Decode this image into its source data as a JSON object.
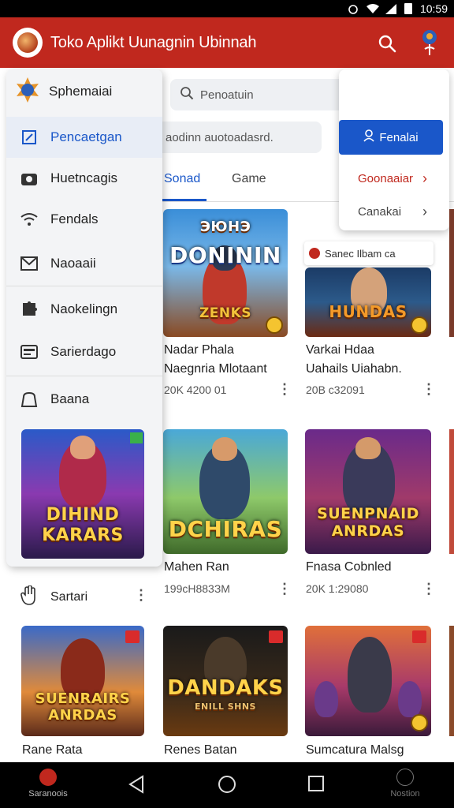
{
  "status_bar": {
    "time": "10:59"
  },
  "app_bar": {
    "title": "Toko Aplikt Uunagnin Ubinnah"
  },
  "search": {
    "placeholder": "Penoatuin"
  },
  "sub_search": {
    "text": "aodinn auotoadasrd."
  },
  "tabs": [
    {
      "label": "Sonad",
      "active": true
    },
    {
      "label": "Game",
      "active": false
    }
  ],
  "drawer": {
    "header": "Sphemaiai",
    "items": [
      {
        "label": "Pencaetgan",
        "icon": "apps-icon",
        "active": true
      },
      {
        "label": "Huetncagis",
        "icon": "camera-icon",
        "active": false
      },
      {
        "label": "Fendals",
        "icon": "wifi-icon",
        "active": false
      },
      {
        "label": "Naoaaii",
        "icon": "mail-icon",
        "active": false
      },
      {
        "label": "Naokelingn",
        "icon": "puzzle-icon",
        "active": false
      },
      {
        "label": "Sarierdago",
        "icon": "card-icon",
        "active": false
      },
      {
        "label": "Baana",
        "icon": "bag-icon",
        "active": false
      }
    ],
    "promo_title": "DIHIND KARARS"
  },
  "popup": {
    "button_label": "Fenalai",
    "items": [
      {
        "label": "Goonaaiar",
        "color": "#c0281e"
      },
      {
        "label": "Canakai",
        "color": "#444444"
      }
    ]
  },
  "chip": {
    "text": "Sanec Ilbam ca"
  },
  "games_row1": [
    {
      "art_title": "DONININ",
      "art_top": "ЭЮНЭ",
      "art_sub": "ZENKS",
      "name": "Nadar Phala\nNaegnria Mlotaant",
      "meta": "20K 4200 01"
    },
    {
      "art_title": "HUNDAS",
      "name": "Varkai Hdaa\nUahails Uiahabn.",
      "meta": "20B c32091"
    }
  ],
  "games_row2": [
    {
      "art_title": "DCHIRAS",
      "name": "Mahen Ran",
      "meta": "199cH883ЗM"
    },
    {
      "art_title": "SUENPNAID ANRDAS",
      "name": "Fnasa Cobnled",
      "meta": "20K 1:29080"
    }
  ],
  "games_row3": [
    {
      "art_title": "SUENRAIRS ANRDAS",
      "name": "Rane Rata",
      "meta": ""
    },
    {
      "art_title": "DANDAKS",
      "art_sub": "ENILL SHNS",
      "name": "Renes Batan",
      "meta": ""
    },
    {
      "art_title": "",
      "name": "Sumcatura Malsg",
      "meta": ""
    }
  ],
  "list_item": {
    "label": "Sartari"
  },
  "nav": {
    "left_label": "Saranoois",
    "right_label": "Nostion"
  },
  "colors": {
    "app_bar": "#c0281e",
    "accent": "#1a57c9"
  }
}
